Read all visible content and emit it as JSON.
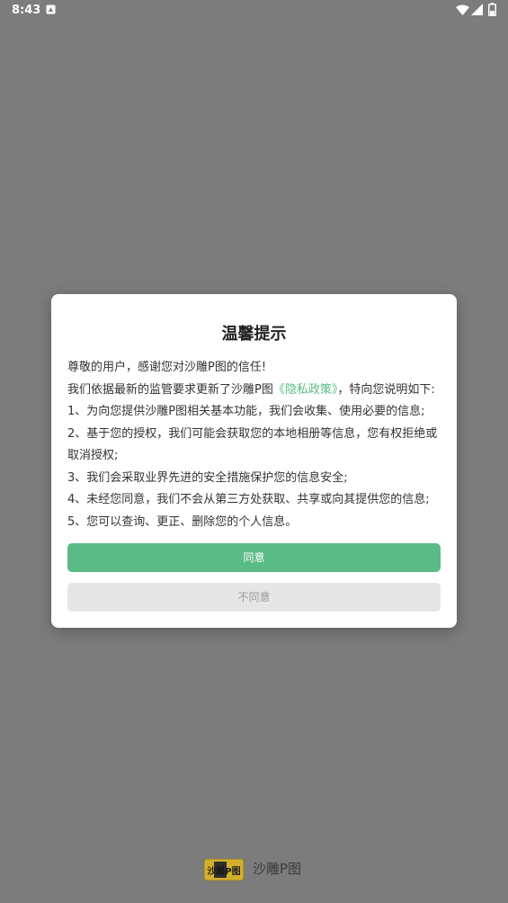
{
  "status_bar": {
    "time": "8:43"
  },
  "dialog": {
    "title": "温馨提示",
    "greeting": "尊敬的用户，感谢您对沙雕P图的信任!",
    "intro_before": "我们依据最新的监管要求更新了沙雕P图",
    "policy_link": "《隐私政策》",
    "intro_after": "，特向您说明如下:",
    "items": [
      "1、为向您提供沙雕P图相关基本功能，我们会收集、使用必要的信息;",
      "2、基于您的授权，我们可能会获取您的本地相册等信息，您有权拒绝或取消授权;",
      "3、我们会采取业界先进的安全措施保护您的信息安全;",
      "4、未经您同意，我们不会从第三方处获取、共享或向其提供您的信息;",
      "5、您可以查询、更正、删除您的个人信息。"
    ],
    "agree_label": "同意",
    "disagree_label": "不同意"
  },
  "brand": {
    "logo_text": "沙雕P图",
    "name": "沙雕P图"
  },
  "colors": {
    "accent": "#5bbb87",
    "overlay": "#7c7c7c",
    "dialog_bg": "#ffffff",
    "disagree_bg": "#e6e6e6"
  }
}
